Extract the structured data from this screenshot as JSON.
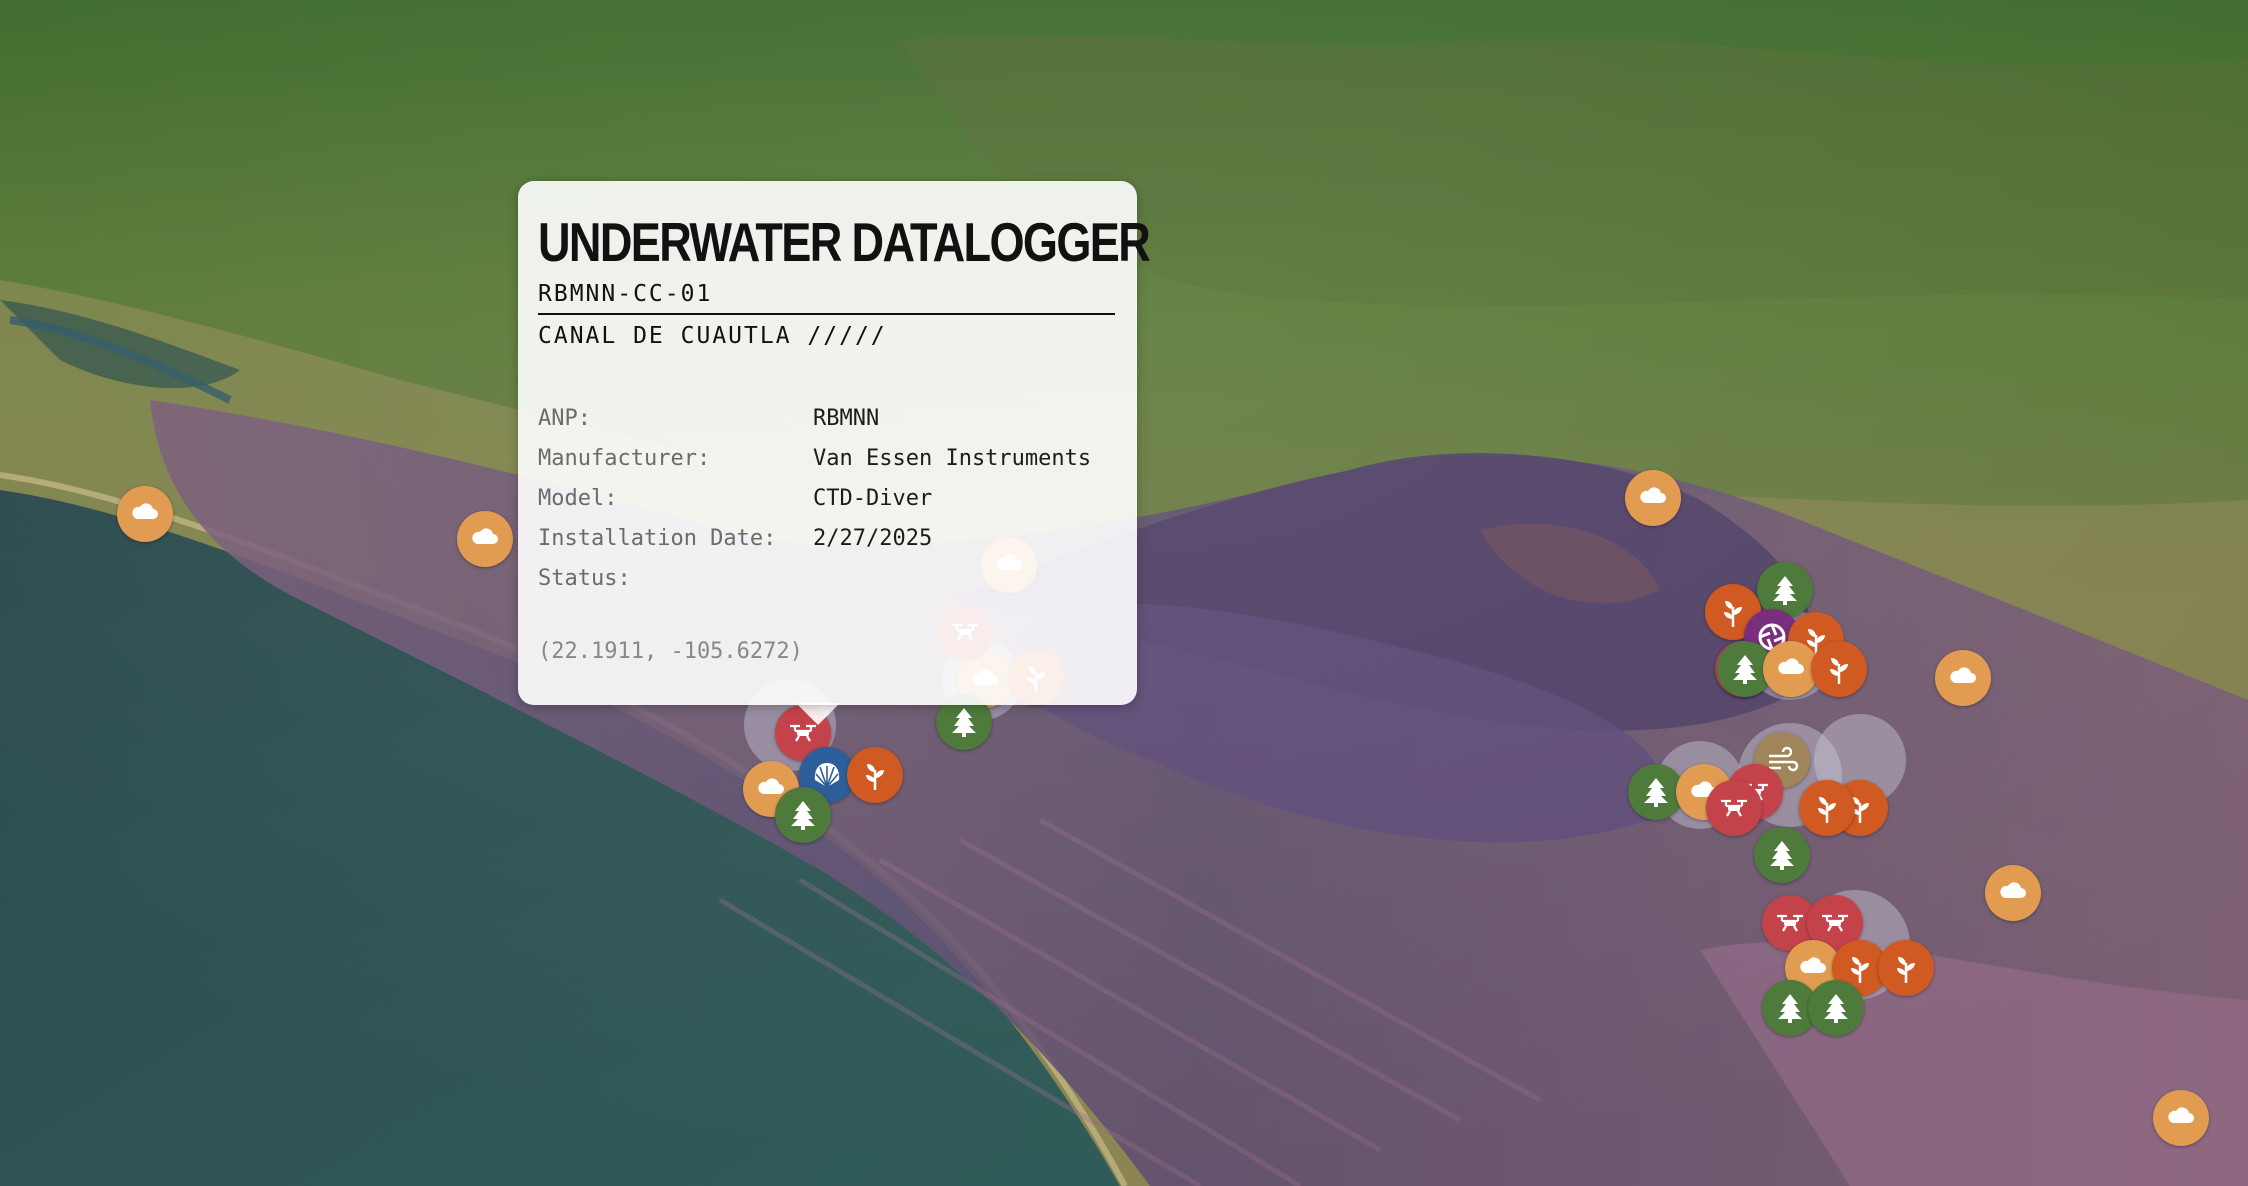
{
  "popup": {
    "title": "UNDERWATER DATALOGGER",
    "code": "RBMNN-CC-01",
    "location": "CANAL DE CUAUTLA /////",
    "fields": [
      {
        "key": "ANP:",
        "value": "RBMNN"
      },
      {
        "key": "Manufacturer:",
        "value": "Van Essen Instruments"
      },
      {
        "key": "Model:",
        "value": "CTD-Diver"
      },
      {
        "key": "Installation Date:",
        "value": "2/27/2025"
      },
      {
        "key": "Status:",
        "value": ""
      }
    ],
    "coordinates": "(22.1911, -105.6272)"
  },
  "marker_types": {
    "weather": {
      "icon": "cloud-icon",
      "color": "#e29c52"
    },
    "drone": {
      "icon": "drone-icon",
      "color": "#c4424a"
    },
    "forest": {
      "icon": "tree-icon",
      "color": "#4e7a3c"
    },
    "plant": {
      "icon": "sprout-icon",
      "color": "#d05a22"
    },
    "datalogger": {
      "icon": "shell-icon",
      "color": "#2d5e9a"
    },
    "camera": {
      "icon": "aperture-icon",
      "color": "#7a2e7e"
    },
    "wind": {
      "icon": "wind-icon",
      "color": "#a0855a"
    }
  }
}
